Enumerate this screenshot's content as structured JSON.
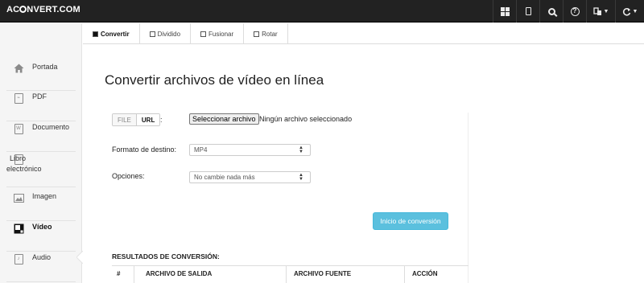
{
  "header": {
    "logo_left": "AC",
    "logo_right": "NVERT.COM",
    "icons": [
      "grid-icon",
      "tablet-icon",
      "search-icon",
      "help-icon",
      "language-icon",
      "refresh-icon"
    ]
  },
  "sidebar": {
    "items": [
      {
        "label": "Portada",
        "icon": "home-icon"
      },
      {
        "label": "PDF",
        "icon": "pdf-icon"
      },
      {
        "label": "Documento",
        "icon": "document-icon"
      },
      {
        "label": "Libro",
        "label2": "electrónico",
        "icon": "book-icon"
      },
      {
        "label": "Imagen",
        "icon": "image-icon"
      },
      {
        "label": "Vídeo",
        "icon": "video-icon"
      },
      {
        "label": "Audio",
        "icon": "audio-icon"
      }
    ]
  },
  "tabs": [
    {
      "label": "Convertir",
      "active": true
    },
    {
      "label": "Dividido"
    },
    {
      "label": "Fusionar"
    },
    {
      "label": "Rotar"
    }
  ],
  "main": {
    "title": "Convertir archivos de vídeo en línea",
    "source_toggle": {
      "file": "FILE",
      "url": "URL",
      "colon": ":"
    },
    "file_button": "Seleccionar archivo",
    "file_status": "Ningún archivo seleccionado",
    "target_label": "Formato de destino:",
    "target_value": "MP4",
    "options_label": "Opciones:",
    "options_value": "No cambie nada más",
    "convert_button": "Inicio de conversión",
    "results_title": "RESULTADOS DE CONVERSIÓN:",
    "columns": [
      "#",
      "ARCHIVO DE SALIDA",
      "ARCHIVO FUENTE",
      "ACCIÓN"
    ]
  },
  "colors": {
    "topbar": "#222222",
    "accent": "#5bc0de"
  }
}
